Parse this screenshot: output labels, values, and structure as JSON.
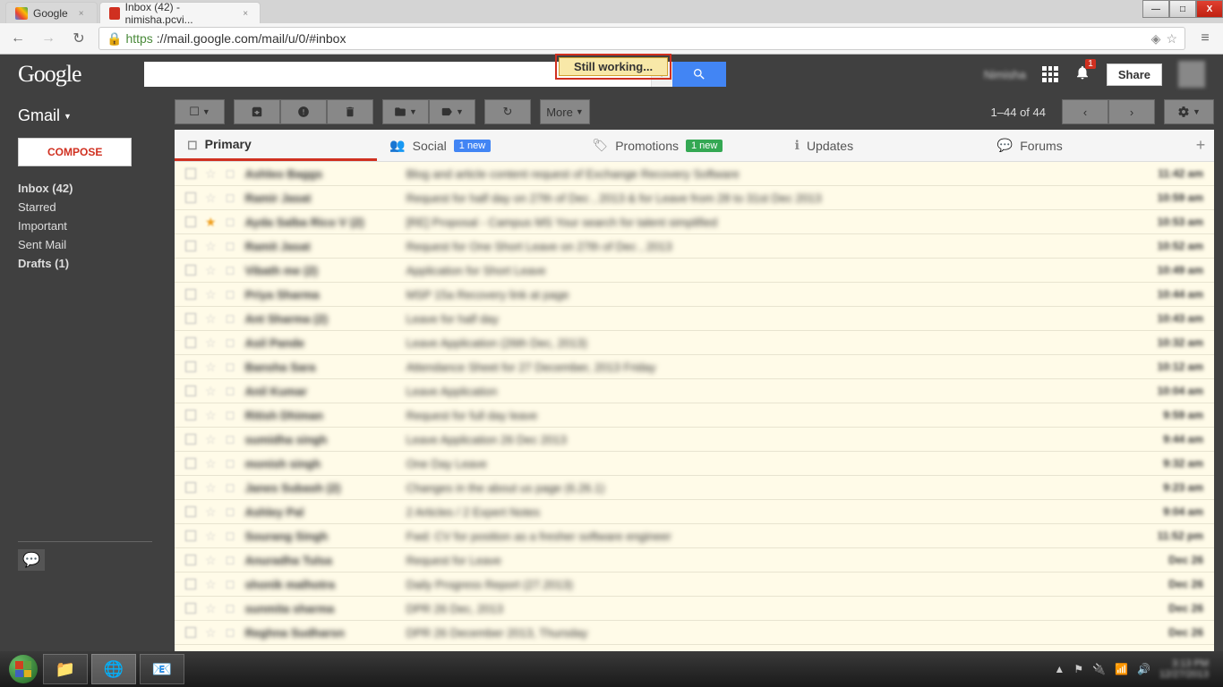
{
  "browser": {
    "tabs": [
      {
        "title": "Google",
        "active": false
      },
      {
        "title": "Inbox (42) - nimisha.pcvi...",
        "active": true
      }
    ],
    "url_https": "https",
    "url_rest": "://mail.google.com/mail/u/0/#inbox",
    "window": {
      "min": "—",
      "max": "□",
      "close": "X"
    }
  },
  "status_toast": "Still working...",
  "header": {
    "logo": "Google",
    "search_placeholder": "",
    "user": "Nimisha",
    "share": "Share",
    "notif_count": "1"
  },
  "sidebar": {
    "app_label": "Gmail",
    "compose": "COMPOSE",
    "items": [
      {
        "label": "Inbox (42)",
        "bold": true
      },
      {
        "label": "Starred",
        "bold": false
      },
      {
        "label": "Important",
        "bold": false
      },
      {
        "label": "Sent Mail",
        "bold": false
      },
      {
        "label": "Drafts (1)",
        "bold": true
      }
    ]
  },
  "toolbar": {
    "more": "More",
    "page_info": "1–44 of 44"
  },
  "categories": [
    {
      "label": "Primary",
      "active": true
    },
    {
      "label": "Social",
      "badge": "1 new",
      "badge_color": "blue"
    },
    {
      "label": "Promotions",
      "badge": "1 new",
      "badge_color": "green"
    },
    {
      "label": "Updates"
    },
    {
      "label": "Forums"
    }
  ],
  "emails": [
    {
      "sender": "Ashleo Baggs",
      "subject": "Blog and article content request of Exchange Recovery Software",
      "time": "11:42 am"
    },
    {
      "sender": "Ramir Jasat",
      "subject": "Request for half day on 27th of Dec , 2013 & for Leave from 28 to 31st Dec 2013",
      "time": "10:59 am"
    },
    {
      "sender": "Ayda Salba Rico V (2)",
      "subject": "[RE] Proposal - Campus MS Your search for talent simplified",
      "time": "10:53 am",
      "starred": true
    },
    {
      "sender": "Ramit Jasat",
      "subject": "Request for One Short Leave on 27th of Dec , 2013",
      "time": "10:52 am"
    },
    {
      "sender": "Vibath me (2)",
      "subject": "Application for Short Leave",
      "time": "10:49 am"
    },
    {
      "sender": "Priya Sharma",
      "subject": "MSP 15a Recovery link at page",
      "time": "10:44 am"
    },
    {
      "sender": "Ant Sharma (2)",
      "subject": "Leave for half day",
      "time": "10:43 am"
    },
    {
      "sender": "Asil Pande",
      "subject": "Leave Application (26th Dec, 2013)",
      "time": "10:32 am"
    },
    {
      "sender": "Bansha Sara",
      "subject": "Attendance Sheet for 27 December, 2013 Friday",
      "time": "10:12 am"
    },
    {
      "sender": "Anil Kumar",
      "subject": "Leave Application",
      "time": "10:04 am"
    },
    {
      "sender": "Ritish Dhiman",
      "subject": "Request for full day leave",
      "time": "9:59 am"
    },
    {
      "sender": "sumidha singh",
      "subject": "Leave Application 26 Dec 2013",
      "time": "9:44 am"
    },
    {
      "sender": "monish singh",
      "subject": "One Day Leave",
      "time": "9:32 am"
    },
    {
      "sender": "Janes Subash (2)",
      "subject": "Changes in the about us page (6.26.1)",
      "time": "9:23 am"
    },
    {
      "sender": "Ashley Pal",
      "subject": "2 Articles / 2 Expert Notes",
      "time": "9:04 am"
    },
    {
      "sender": "Sourang Singh",
      "subject": "Fwd: CV for position as a fresher software engineer",
      "time": "11:52 pm"
    },
    {
      "sender": "Anuradha Tulsa",
      "subject": "Request for Leave",
      "time": "Dec 26"
    },
    {
      "sender": "shonik malhotra",
      "subject": "Daily Progress Report (27.2013)",
      "time": "Dec 26"
    },
    {
      "sender": "sunmita sharma",
      "subject": "DPR 26 Dec, 2013",
      "time": "Dec 26"
    },
    {
      "sender": "Reghna Sudharsn",
      "subject": "DPR 26 December 2013, Thursday",
      "time": "Dec 26"
    }
  ]
}
